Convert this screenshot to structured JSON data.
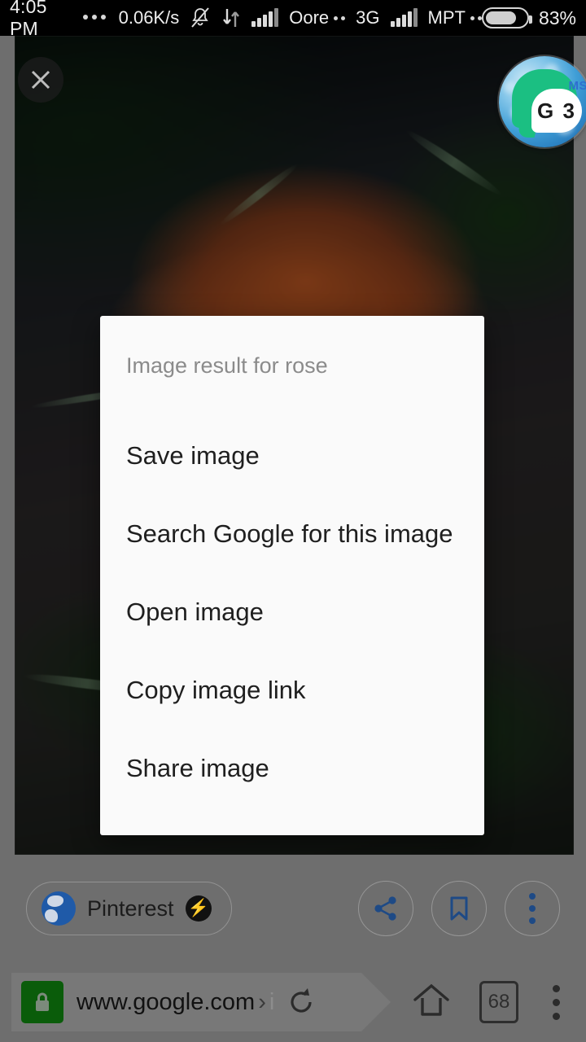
{
  "status_bar": {
    "time": "4:05 PM",
    "network_speed": "0.06K/s",
    "carrier_1": "Oore",
    "network_type": "3G",
    "carrier_2": "MPT",
    "battery_percent": "83%",
    "icons": {
      "overflow": "more-dots-icon",
      "mute": "bell-muted-icon",
      "data_transfer": "data-arrows-icon",
      "signal": "signal-bars-icon",
      "battery": "battery-icon"
    }
  },
  "viewer": {
    "close_label": "close-icon",
    "photo_description": "orange-rose-photo"
  },
  "floating_bubble": {
    "badge_text": "G 3",
    "corner_label": "MS"
  },
  "dialog": {
    "title": "Image result for rose",
    "items": [
      {
        "label": "Save image"
      },
      {
        "label": "Search Google for this image"
      },
      {
        "label": "Open image"
      },
      {
        "label": "Copy image link"
      },
      {
        "label": "Share image"
      }
    ]
  },
  "action_bar": {
    "site_name": "Pinterest",
    "amp_badge": "amp-lightning-icon",
    "buttons": [
      {
        "name": "share-button",
        "icon": "share-icon"
      },
      {
        "name": "bookmark-button",
        "icon": "bookmark-icon"
      },
      {
        "name": "overflow-button",
        "icon": "more-vertical-icon"
      }
    ]
  },
  "browser_bar": {
    "security_icon": "lock-icon",
    "url": "www.google.com",
    "url_separator": "›",
    "url_fragment": "i",
    "reload_icon": "reload-icon",
    "home_icon": "home-icon",
    "tab_count": "68",
    "menu_icon": "more-vertical-icon"
  },
  "colors": {
    "chrome_gray": "#6e6e6e",
    "dialog_bg": "#fafafa",
    "accent_blue": "#1e4a86",
    "lock_green": "#0a5c0a"
  }
}
